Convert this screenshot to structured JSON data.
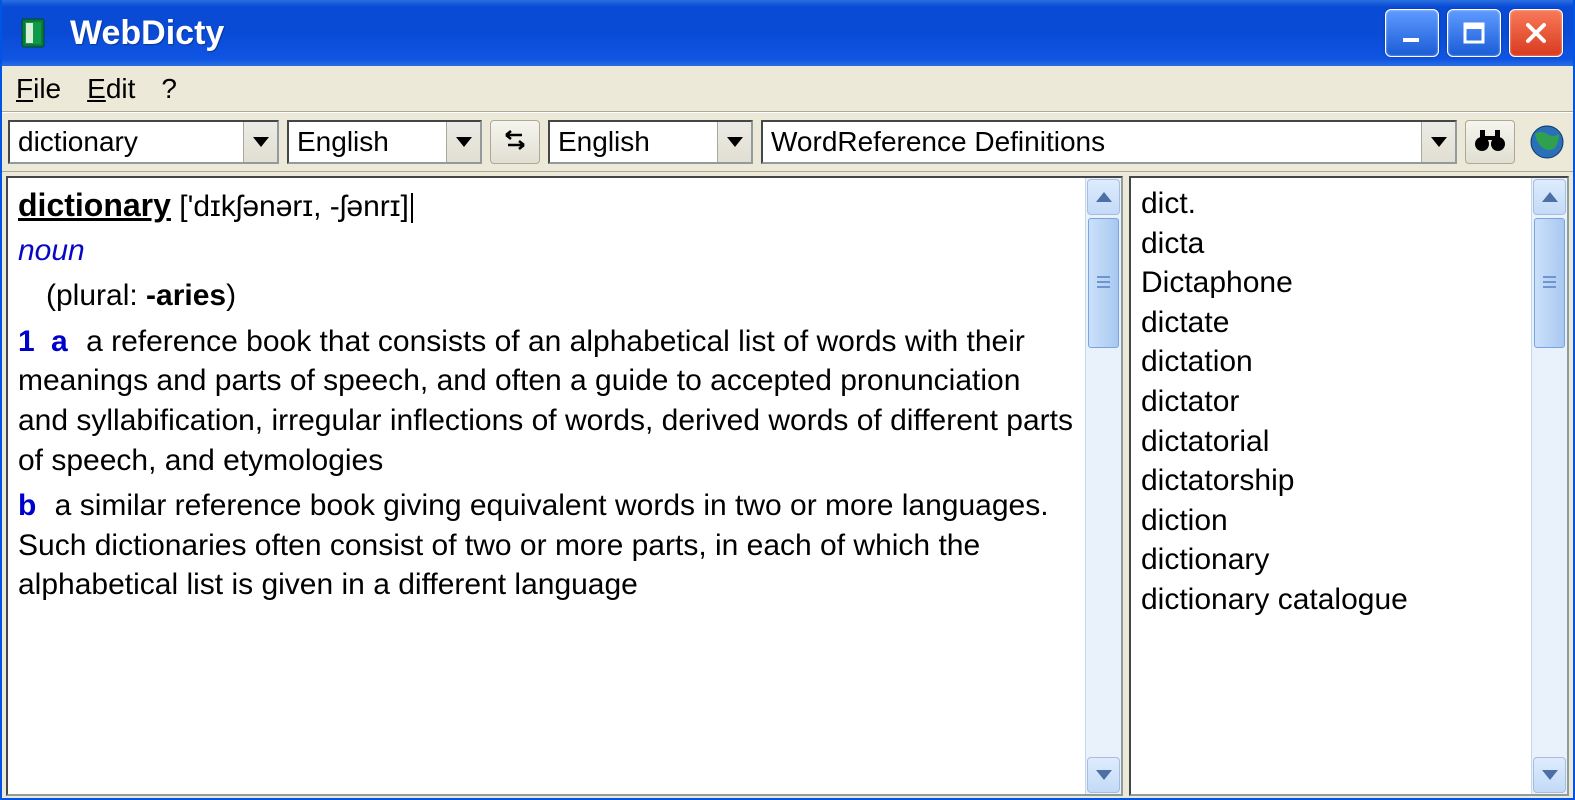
{
  "window": {
    "title": "WebDicty"
  },
  "menu": {
    "file": "File",
    "edit": "Edit",
    "help": "?"
  },
  "toolbar": {
    "search_term": "dictionary",
    "lang_from": "English",
    "lang_to": "English",
    "source": "WordReference Definitions"
  },
  "definition": {
    "headword": "dictionary",
    "pronunciation": "['dɪkʃənərɪ, -ʃənrɪ]",
    "pos": "noun",
    "plural_label": "(plural:   ",
    "plural_suffix": "-aries",
    "plural_close": ")",
    "sense1_num": "1",
    "sense1a_letter": "a",
    "sense1a_text": "a reference book that consists of an alphabetical list of words with their meanings and parts of speech, and often a guide to accepted pronunciation and syllabification, irregular inflections of words, derived words of different parts of speech, and etymologies",
    "sense1b_letter": "b",
    "sense1b_text": "a similar reference book giving equivalent words in two or more languages. Such dictionaries often consist of two or more parts, in each of which the alphabetical list is given in a different language"
  },
  "word_list": [
    "dict.",
    "dicta",
    "Dictaphone",
    "dictate",
    "dictation",
    "dictator",
    "dictatorial",
    "dictatorship",
    "diction",
    "dictionary",
    "dictionary catalogue"
  ]
}
